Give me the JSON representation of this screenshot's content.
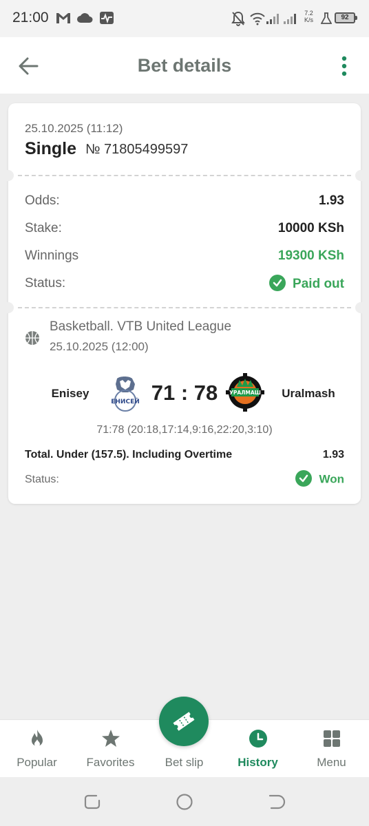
{
  "status_bar": {
    "time": "21:00",
    "net_speed_value": "7.2",
    "net_speed_unit": "K/s",
    "battery": "92",
    "icons": [
      "gmail-icon",
      "cloud-icon",
      "activity-icon",
      "notifications-off-icon",
      "wifi-icon",
      "signal-icon",
      "signal-icon",
      "lab-icon",
      "battery-icon"
    ]
  },
  "header": {
    "title": "Bet details",
    "back_icon": "arrow-left-icon",
    "menu_icon": "more-vertical-icon"
  },
  "bet": {
    "placed_at": "25.10.2025 (11:12)",
    "type": "Single",
    "number": "№ 71805499597",
    "rows": [
      {
        "label": "Odds:",
        "value": "1.93"
      },
      {
        "label": "Stake:",
        "value": "10000 KSh"
      },
      {
        "label": "Winnings",
        "value": "19300 KSh"
      },
      {
        "label": "Status:",
        "value": "Paid out"
      }
    ]
  },
  "event": {
    "sport_icon": "basketball-icon",
    "league": "Basketball. VTB United League",
    "start_time": "25.10.2025 (12:00)",
    "team_home": "Enisey",
    "team_away": "Uralmash",
    "score": "71 : 78",
    "periods": "71:78 (20:18,17:14,9:16,22:20,3:10)",
    "market": "Total. Under (157.5). Including Overtime",
    "odds": "1.93",
    "status_label": "Status:",
    "status": "Won",
    "home_logo_text": "ЕНИСЕЙ",
    "away_logo_text": "УРАЛМАШ"
  },
  "bottom_nav": {
    "items": [
      {
        "label": "Popular",
        "icon": "flame-icon"
      },
      {
        "label": "Favorites",
        "icon": "star-icon"
      },
      {
        "label": "Bet slip",
        "icon": "ticket-icon"
      },
      {
        "label": "History",
        "icon": "clock-icon"
      },
      {
        "label": "Menu",
        "icon": "grid-icon"
      }
    ],
    "active": "History"
  },
  "colors": {
    "accent": "#1f8a5e",
    "success": "#3aa65a",
    "muted": "#6d7672",
    "background": "#eeeeee"
  }
}
